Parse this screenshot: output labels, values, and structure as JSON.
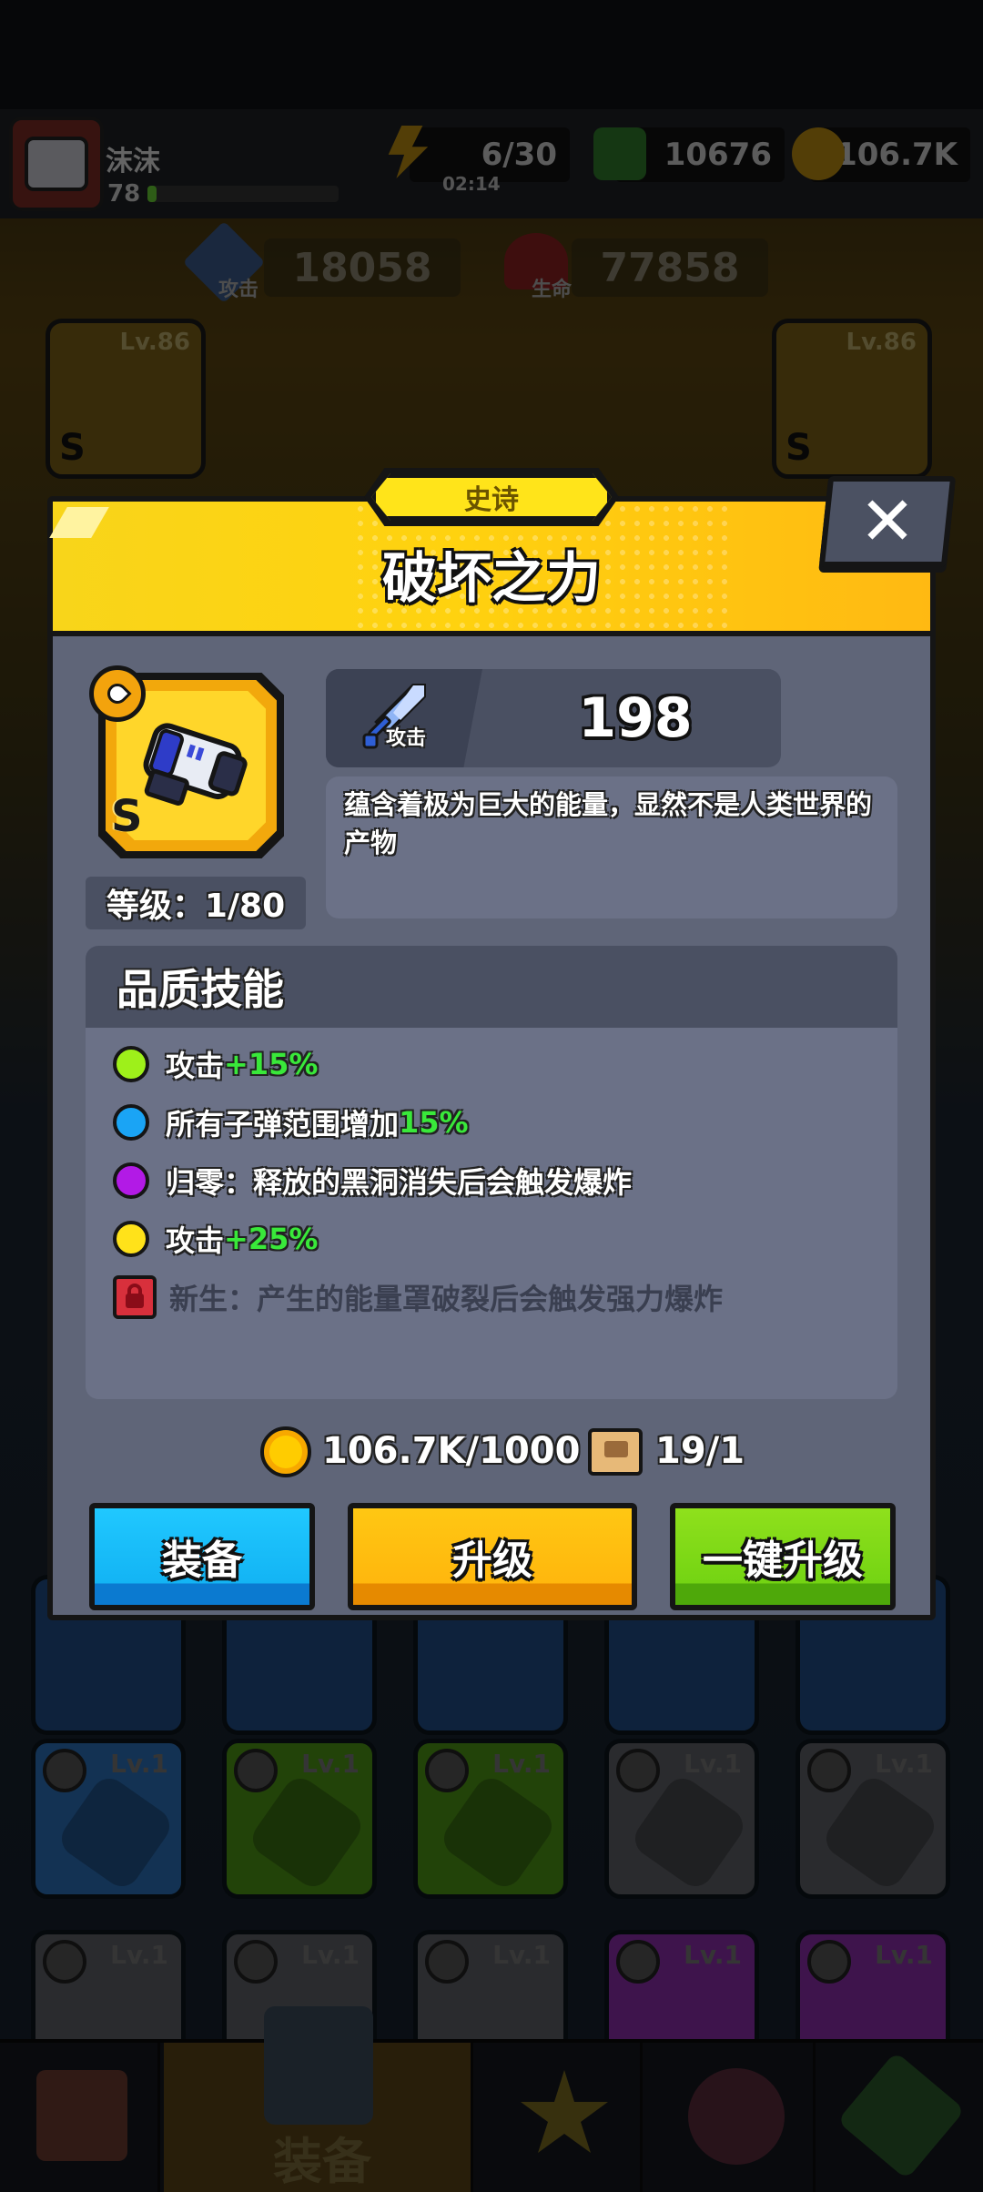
{
  "player": {
    "name": "沫沫",
    "level": "78"
  },
  "resources": {
    "energy": "6/30",
    "energy_timer": "02:14",
    "gems": "10676",
    "coins": "106.7K"
  },
  "stats": {
    "attack_label": "攻击",
    "attack_value": "18058",
    "hp_label": "生命",
    "hp_value": "77858"
  },
  "background_slots": [
    {
      "level": "Lv.86",
      "grade": "S"
    },
    {
      "level": "Lv.86",
      "grade": "S"
    }
  ],
  "background_cards": [
    {
      "level": "Lv.1",
      "color": "#2a6fb8"
    },
    {
      "level": "Lv.1",
      "color": "#5aa818"
    },
    {
      "level": "Lv.1",
      "color": "#5aa818"
    },
    {
      "level": "Lv.1",
      "color": "#7a7a7a"
    },
    {
      "level": "Lv.1",
      "color": "#7a7a7a"
    },
    {
      "level": "Lv.1",
      "color": "#7a7a7a"
    },
    {
      "level": "Lv.1",
      "color": "#7a7a7a"
    },
    {
      "level": "Lv.1",
      "color": "#7a7a7a"
    },
    {
      "level": "Lv.1",
      "color": "#a83ac8"
    },
    {
      "level": "Lv.1",
      "color": "#a83ac8"
    }
  ],
  "bottom_nav": {
    "active_label": "装备"
  },
  "modal": {
    "rarity": "史诗",
    "title": "破坏之力",
    "grade": "S",
    "level_label": "等级：1/80",
    "attack_label": "攻击",
    "attack_value": "198",
    "description": "蕴含着极为巨大的能量，显然不是人类世界的产物",
    "skills_title": "品质技能",
    "skills": [
      {
        "color": "#9ef01a",
        "text": "攻击",
        "bonus": "+15%",
        "locked": false
      },
      {
        "color": "#1aa4f5",
        "text": "所有子弹范围增加",
        "bonus": "15%",
        "locked": false
      },
      {
        "color": "#b21ae6",
        "text": "归零：释放的黑洞消失后会触发爆炸",
        "bonus": "",
        "locked": false
      },
      {
        "color": "#ffe21a",
        "text": "攻击",
        "bonus": "+25%",
        "locked": false
      },
      {
        "color": "#d8303c",
        "text": "新生：产生的能量罩破裂后会触发强力爆炸",
        "bonus": "",
        "locked": true
      }
    ],
    "cost_coins": "106.7K/1000",
    "cost_scrolls": "19/1",
    "buttons": {
      "equip": "装备",
      "upgrade": "升级",
      "one_click_upgrade": "一键升级"
    },
    "close_icon": "close-icon"
  },
  "colors": {
    "header_yellow": "#ffd20f",
    "panel_gray": "#5f6578",
    "bonus_green": "#39e83a",
    "equip_blue": "#13b4f4",
    "upgrade_orange": "#ffb70d",
    "oneclick_green": "#74d413"
  }
}
